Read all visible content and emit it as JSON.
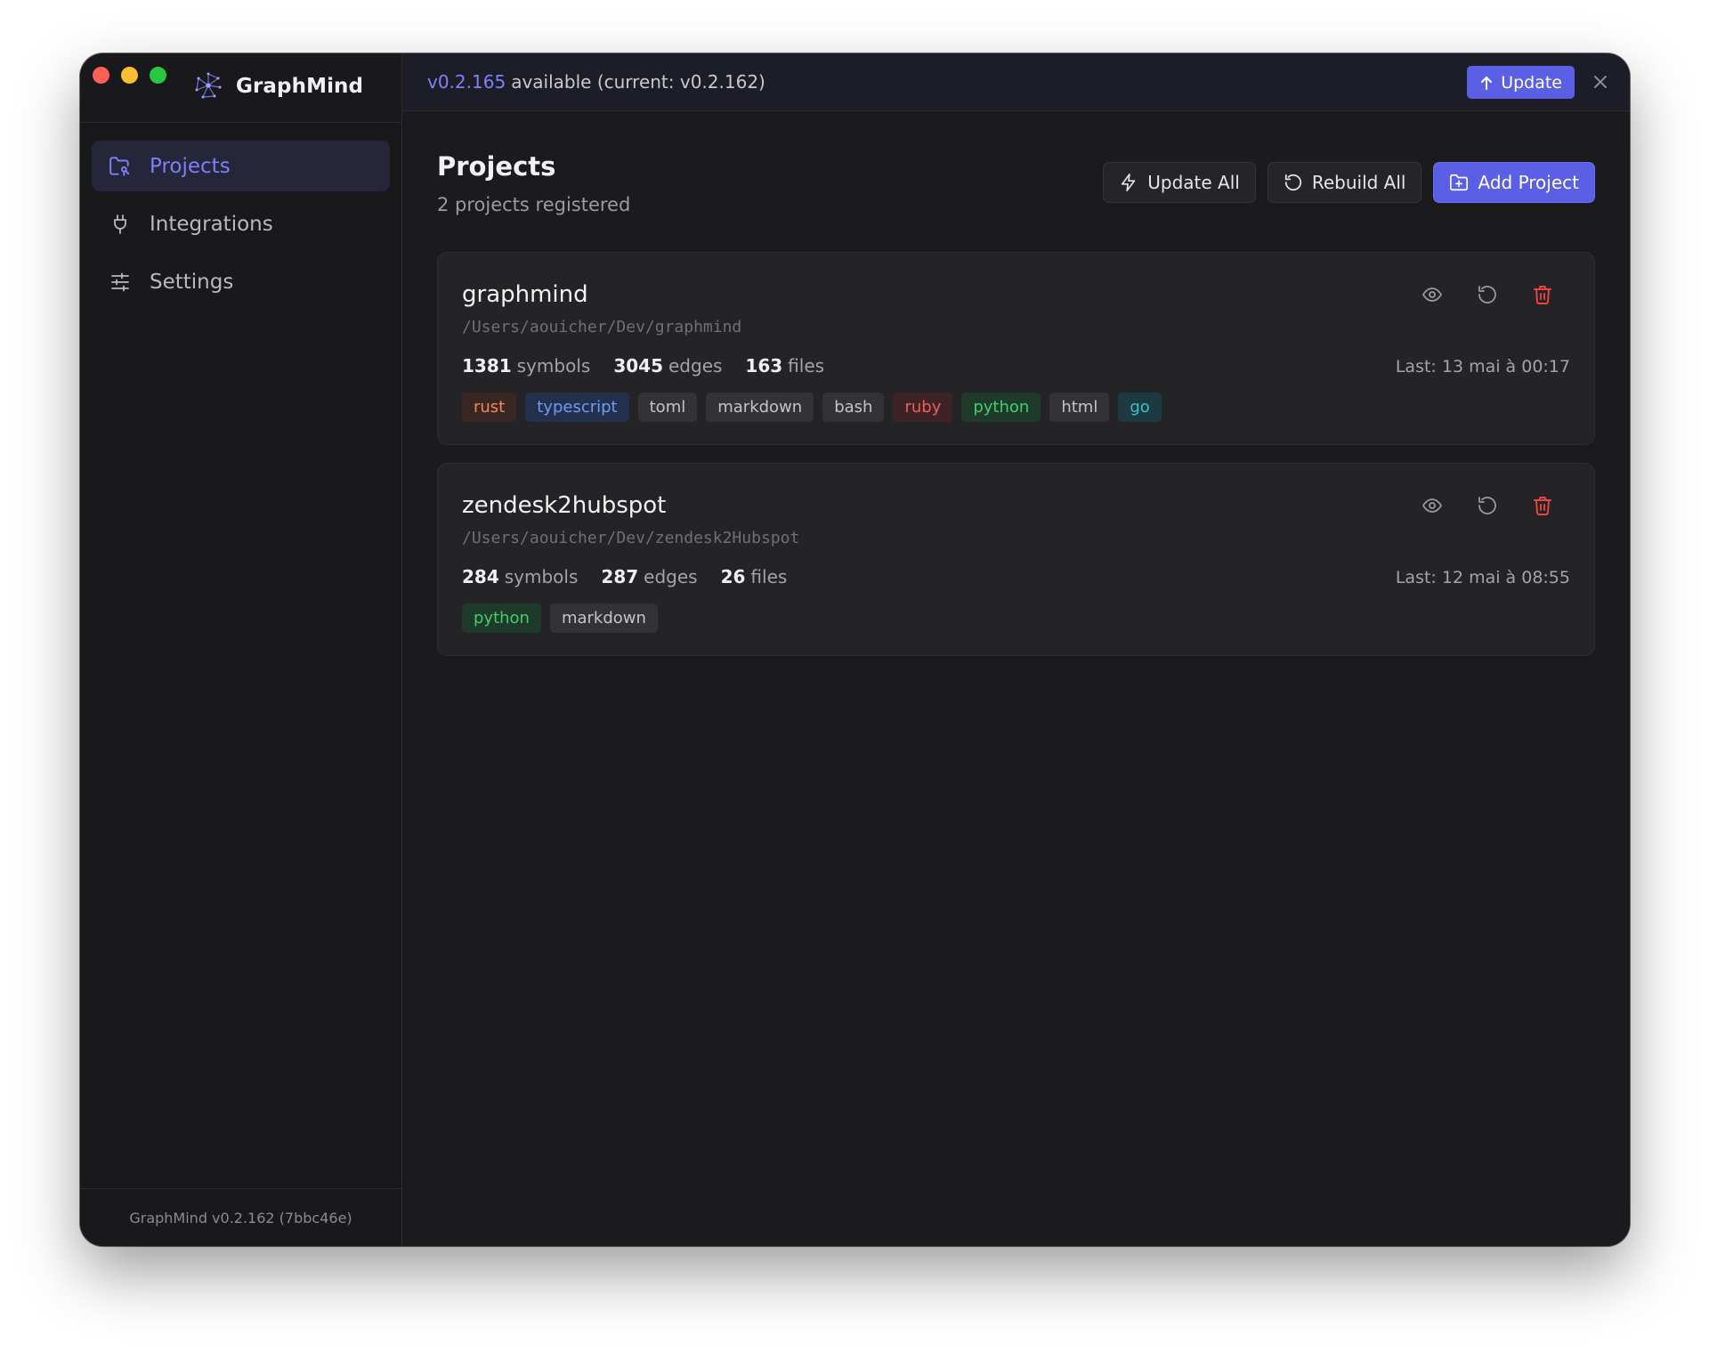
{
  "app": {
    "name": "GraphMind",
    "version_footer": "GraphMind v0.2.162 (7bbc46e)"
  },
  "sidebar": {
    "items": [
      {
        "label": "Projects",
        "icon": "projects-folder-icon",
        "active": true
      },
      {
        "label": "Integrations",
        "icon": "plug-icon",
        "active": false
      },
      {
        "label": "Settings",
        "icon": "sliders-icon",
        "active": false
      }
    ]
  },
  "banner": {
    "new_version": "v0.2.165",
    "message": "available (current: v0.2.162)",
    "update_label": "Update"
  },
  "page": {
    "title": "Projects",
    "subtitle": "2 projects registered",
    "actions": {
      "update_all": "Update All",
      "rebuild_all": "Rebuild All",
      "add_project": "Add Project"
    }
  },
  "projects": [
    {
      "name": "graphmind",
      "path": "/Users/aouicher/Dev/graphmind",
      "symbols": "1381",
      "symbols_label": "symbols",
      "edges": "3045",
      "edges_label": "edges",
      "files": "163",
      "files_label": "files",
      "last": "Last: 13 mai à 00:17",
      "tags": [
        {
          "label": "rust",
          "bg": "#3a2622",
          "fg": "#f08a5d"
        },
        {
          "label": "typescript",
          "bg": "#23304d",
          "fg": "#6f9cf3"
        },
        {
          "label": "toml",
          "bg": "#333337",
          "fg": "#c4c4c9"
        },
        {
          "label": "markdown",
          "bg": "#333337",
          "fg": "#c4c4c9"
        },
        {
          "label": "bash",
          "bg": "#333337",
          "fg": "#c4c4c9"
        },
        {
          "label": "ruby",
          "bg": "#3d2326",
          "fg": "#ef5f5f"
        },
        {
          "label": "python",
          "bg": "#1f3a2a",
          "fg": "#3fcf6d"
        },
        {
          "label": "html",
          "bg": "#333337",
          "fg": "#c4c4c9"
        },
        {
          "label": "go",
          "bg": "#1c3a40",
          "fg": "#36c3cf"
        }
      ]
    },
    {
      "name": "zendesk2hubspot",
      "path": "/Users/aouicher/Dev/zendesk2Hubspot",
      "symbols": "284",
      "symbols_label": "symbols",
      "edges": "287",
      "edges_label": "edges",
      "files": "26",
      "files_label": "files",
      "last": "Last: 12 mai à 08:55",
      "tags": [
        {
          "label": "python",
          "bg": "#1f3a2a",
          "fg": "#3fcf6d"
        },
        {
          "label": "markdown",
          "bg": "#333337",
          "fg": "#c4c4c9"
        }
      ]
    }
  ],
  "colors": {
    "accent": "#5b5fe6",
    "accent_text": "#7c7ff5",
    "danger": "#ef4444"
  }
}
